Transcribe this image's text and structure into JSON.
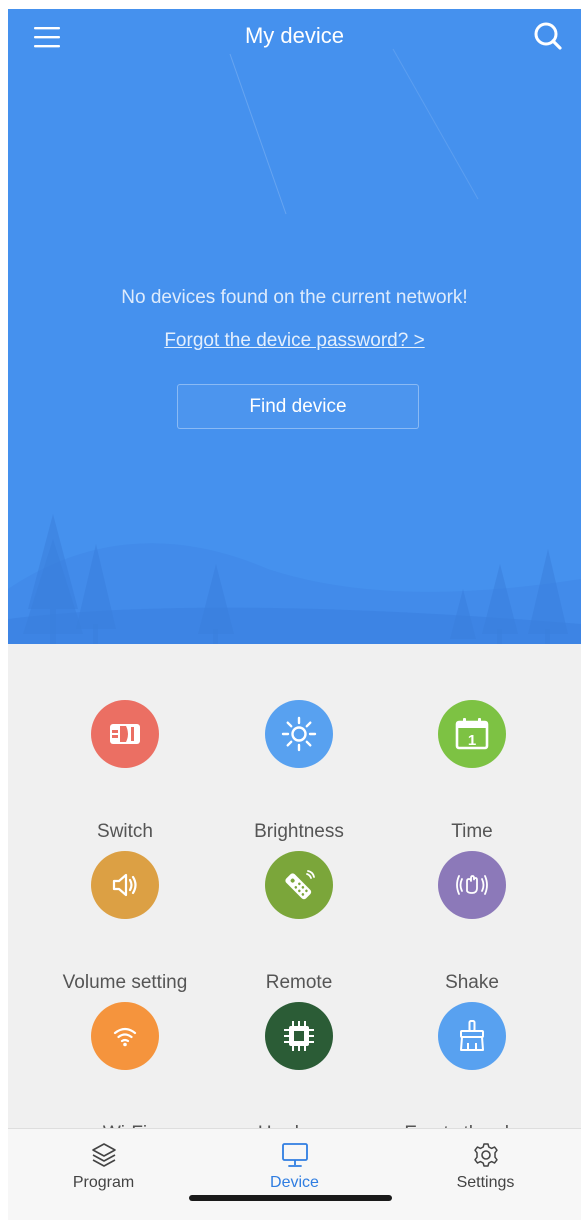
{
  "header": {
    "title": "My device",
    "menu_icon": "hamburger-menu-icon",
    "search_icon": "search-icon"
  },
  "hero": {
    "message": "No devices found on the current network!",
    "forgot_link": "Forgot the device password? >",
    "find_button": "Find device",
    "background_color": "#4591ee"
  },
  "features": [
    {
      "label": "Switch",
      "icon": "power-plug-icon",
      "color": "#eb6f63"
    },
    {
      "label": "Brightness",
      "icon": "sun-icon",
      "color": "#58a1f0"
    },
    {
      "label": "Time",
      "icon": "calendar-icon",
      "color": "#7dc243",
      "icon_text": "1"
    },
    {
      "label": "Volume setting",
      "icon": "speaker-icon",
      "color": "#dca044"
    },
    {
      "label": "Remote",
      "icon": "remote-control-icon",
      "color": "#7ba63a"
    },
    {
      "label": "Shake",
      "icon": "shake-hand-icon",
      "color": "#8c79b9"
    },
    {
      "label": "Wi-Fi",
      "icon": "wifi-icon",
      "color": "#f5943d"
    },
    {
      "label": "Hardware",
      "icon": "chip-icon",
      "color": "#2b5c36"
    },
    {
      "label": "Empty the show",
      "icon": "broom-icon",
      "color": "#58a1f0"
    }
  ],
  "bottom_nav": [
    {
      "label": "Program",
      "icon": "layers-icon",
      "active": false
    },
    {
      "label": "Device",
      "icon": "monitor-icon",
      "active": true
    },
    {
      "label": "Settings",
      "icon": "gear-icon",
      "active": false
    }
  ],
  "accent_color": "#2f7de1"
}
